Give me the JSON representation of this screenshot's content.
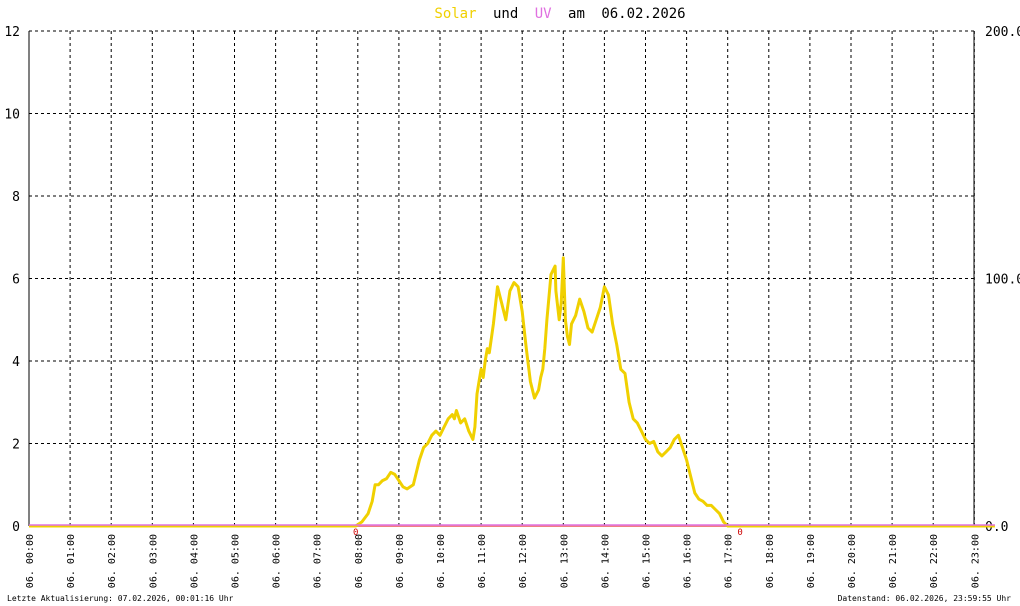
{
  "title": {
    "solar": "Solar",
    "und": "und",
    "uv": "UV",
    "am": "am",
    "date": "06.02.2026"
  },
  "footer": {
    "last_update": "Letzte Aktualisierung: 07.02.2026, 00:01:16 Uhr",
    "data_state": "Datenstand: 06.02.2026, 23:59:55 Uhr"
  },
  "colors": {
    "solar": "#f0d000",
    "uv": "#e070e0",
    "baseline": "#f08080",
    "grid": "#000000",
    "zero_marker": "#cc0000"
  },
  "chart_data": {
    "type": "line",
    "x_range_hours": [
      0,
      23.5
    ],
    "left_axis": {
      "ylim": [
        0,
        12
      ],
      "ticks": [
        "0",
        "2",
        "4",
        "6",
        "8",
        "10",
        "12"
      ]
    },
    "right_axis": {
      "ylim": [
        0,
        200
      ],
      "ticks": [
        "0.0",
        "100.0",
        "200.0"
      ]
    },
    "x_tick_labels": [
      "06. 00:00",
      "06. 01:00",
      "06. 02:00",
      "06. 03:00",
      "06. 04:00",
      "06. 05:00",
      "06. 06:00",
      "06. 07:00",
      "06. 08:00",
      "06. 09:00",
      "06. 10:00",
      "06. 11:00",
      "06. 12:00",
      "06. 13:00",
      "06. 14:00",
      "06. 15:00",
      "06. 16:00",
      "06. 17:00",
      "06. 18:00",
      "06. 19:00",
      "06. 20:00",
      "06. 21:00",
      "06. 22:00",
      "06. 23:00"
    ],
    "zero_markers": [
      {
        "hour": 7.95,
        "label": "0"
      },
      {
        "hour": 17.3,
        "label": "0"
      }
    ],
    "series": [
      {
        "name": "Solar",
        "x": [
          0,
          7.95,
          8.1,
          8.25,
          8.35,
          8.42,
          8.5,
          8.6,
          8.7,
          8.8,
          8.9,
          9.0,
          9.1,
          9.2,
          9.35,
          9.5,
          9.6,
          9.7,
          9.8,
          9.9,
          10.0,
          10.1,
          10.2,
          10.3,
          10.35,
          10.4,
          10.5,
          10.6,
          10.7,
          10.8,
          10.85,
          10.9,
          10.95,
          11.0,
          11.05,
          11.1,
          11.15,
          11.2,
          11.3,
          11.4,
          11.5,
          11.6,
          11.7,
          11.8,
          11.9,
          12.0,
          12.1,
          12.2,
          12.3,
          12.4,
          12.45,
          12.5,
          12.55,
          12.6,
          12.7,
          12.8,
          12.82,
          12.9,
          12.95,
          13.0,
          13.05,
          13.1,
          13.15,
          13.2,
          13.3,
          13.4,
          13.5,
          13.6,
          13.7,
          13.8,
          13.9,
          14.0,
          14.1,
          14.2,
          14.3,
          14.4,
          14.5,
          14.6,
          14.7,
          14.8,
          14.9,
          15.0,
          15.1,
          15.2,
          15.3,
          15.4,
          15.5,
          15.6,
          15.7,
          15.8,
          15.9,
          16.0,
          16.1,
          16.2,
          16.3,
          16.4,
          16.5,
          16.6,
          16.7,
          16.8,
          16.9,
          17.0,
          17.1,
          17.2,
          17.3,
          17.5,
          23.5
        ],
        "y": [
          0,
          0,
          0.1,
          0.3,
          0.6,
          1.0,
          1.0,
          1.1,
          1.15,
          1.3,
          1.25,
          1.1,
          0.95,
          0.9,
          1.0,
          1.6,
          1.9,
          2.0,
          2.2,
          2.3,
          2.2,
          2.4,
          2.6,
          2.7,
          2.6,
          2.8,
          2.5,
          2.6,
          2.3,
          2.1,
          2.4,
          3.2,
          3.5,
          3.8,
          3.6,
          4.0,
          4.3,
          4.2,
          4.9,
          5.8,
          5.4,
          5.0,
          5.7,
          5.9,
          5.8,
          5.2,
          4.3,
          3.5,
          3.1,
          3.3,
          3.6,
          3.8,
          4.3,
          5.0,
          6.1,
          6.3,
          5.7,
          5.0,
          5.4,
          6.5,
          5.0,
          4.6,
          4.4,
          4.9,
          5.1,
          5.5,
          5.2,
          4.8,
          4.7,
          5.0,
          5.3,
          5.8,
          5.6,
          4.9,
          4.4,
          3.8,
          3.7,
          3.0,
          2.6,
          2.5,
          2.3,
          2.1,
          2.0,
          2.05,
          1.8,
          1.7,
          1.8,
          1.9,
          2.1,
          2.2,
          1.9,
          1.6,
          1.2,
          0.8,
          0.65,
          0.6,
          0.5,
          0.5,
          0.4,
          0.3,
          0.1,
          0,
          0,
          0,
          0,
          0,
          0
        ]
      },
      {
        "name": "UV",
        "x": [
          0,
          23.5
        ],
        "y": [
          0,
          0
        ]
      }
    ]
  }
}
